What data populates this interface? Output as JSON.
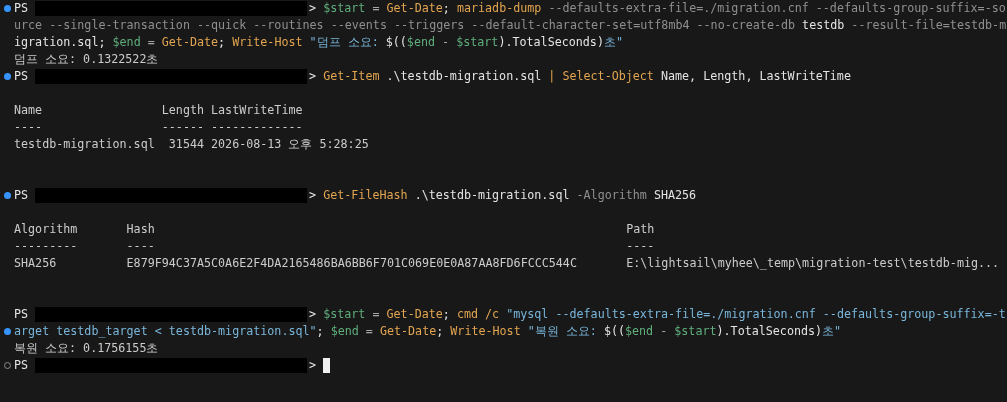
{
  "lines": [
    {
      "kind": "prompt",
      "dot": true,
      "dot_filled": true,
      "prompt": "PS",
      "prompt_end": ">",
      "segments": [
        {
          "kind": "variable",
          "text": "$start"
        },
        {
          "kind": "operator",
          "text": " = "
        },
        {
          "kind": "command",
          "text": "Get-Date"
        },
        {
          "kind": "plain",
          "text": "; "
        },
        {
          "kind": "command",
          "text": "mariadb-dump"
        },
        {
          "kind": "parameter",
          "text": " --defaults-extra-file=./migration.cnf --defaults-group-suffix=-so"
        }
      ]
    },
    {
      "kind": "code",
      "dot": false,
      "segments": [
        {
          "kind": "parameter",
          "text": "urce --single-transaction --quick --routines --events --triggers --default-character-set=utf8mb4 --no-create-db"
        },
        {
          "kind": "plain",
          "text": " testdb "
        },
        {
          "kind": "parameter",
          "text": "--result-file=testdb-m"
        }
      ]
    },
    {
      "kind": "code",
      "dot": false,
      "segments": [
        {
          "kind": "plain",
          "text": "igration.sql; "
        },
        {
          "kind": "variable",
          "text": "$end"
        },
        {
          "kind": "operator",
          "text": " = "
        },
        {
          "kind": "command",
          "text": "Get-Date"
        },
        {
          "kind": "plain",
          "text": "; "
        },
        {
          "kind": "command",
          "text": "Write-Host"
        },
        {
          "kind": "string",
          "text": " \"덤프 소요: "
        },
        {
          "kind": "plain",
          "text": "$(("
        },
        {
          "kind": "variable",
          "text": "$end"
        },
        {
          "kind": "operator",
          "text": " - "
        },
        {
          "kind": "variable",
          "text": "$start"
        },
        {
          "kind": "plain",
          "text": ").TotalSeconds)"
        },
        {
          "kind": "string",
          "text": "초\""
        }
      ]
    },
    {
      "kind": "output",
      "dot": false,
      "text": "덤프 소요: 0.1322522초"
    },
    {
      "kind": "prompt",
      "dot": true,
      "dot_filled": true,
      "prompt": "PS",
      "prompt_end": ">",
      "segments": [
        {
          "kind": "command",
          "text": "Get-Item"
        },
        {
          "kind": "plain",
          "text": " .\\testdb-migration.sql "
        },
        {
          "kind": "command",
          "text": "| Select-Object"
        },
        {
          "kind": "plain",
          "text": " Name, Length, LastWriteTime"
        }
      ]
    },
    {
      "kind": "blank",
      "dot": false
    },
    {
      "kind": "output",
      "dot": false,
      "text": "Name                 Length LastWriteTime"
    },
    {
      "kind": "output",
      "dot": false,
      "text": "----                 ------ -------------"
    },
    {
      "kind": "output",
      "dot": false,
      "text": "testdb-migration.sql  31544 2026-08-13 오후 5:28:25"
    },
    {
      "kind": "blank",
      "dot": false
    },
    {
      "kind": "blank",
      "dot": false
    },
    {
      "kind": "prompt",
      "dot": true,
      "dot_filled": true,
      "prompt": "PS",
      "prompt_end": ">",
      "segments": [
        {
          "kind": "command",
          "text": "Get-FileHash"
        },
        {
          "kind": "plain",
          "text": " .\\testdb-migration.sql "
        },
        {
          "kind": "parameter",
          "text": "-Algorithm"
        },
        {
          "kind": "plain",
          "text": " SHA256"
        }
      ]
    },
    {
      "kind": "blank",
      "dot": false
    },
    {
      "kind": "output",
      "dot": false,
      "text": "Algorithm       Hash                                                                   Path"
    },
    {
      "kind": "output",
      "dot": false,
      "text": "---------       ----                                                                   ----"
    },
    {
      "kind": "output",
      "dot": false,
      "text": "SHA256          E879F94C37A5C0A6E2F4DA2165486BA6BB6F701C069E0E0A87AA8FD6FCCC544C       E:\\lightsail\\myhee\\_temp\\migration-test\\testdb-mig..."
    },
    {
      "kind": "blank",
      "dot": false
    },
    {
      "kind": "blank",
      "dot": false
    },
    {
      "kind": "prompt",
      "dot": false,
      "prompt": "PS",
      "prompt_end": ">",
      "segments": [
        {
          "kind": "variable",
          "text": "$start"
        },
        {
          "kind": "operator",
          "text": " = "
        },
        {
          "kind": "command",
          "text": "Get-Date"
        },
        {
          "kind": "plain",
          "text": "; "
        },
        {
          "kind": "command",
          "text": "cmd /c"
        },
        {
          "kind": "string",
          "text": " \"mysql --defaults-extra-file=./migration.cnf --defaults-group-suffix=-t"
        }
      ]
    },
    {
      "kind": "code",
      "dot": true,
      "dot_filled": true,
      "segments": [
        {
          "kind": "string",
          "text": "arget testdb_target < testdb-migration.sql\""
        },
        {
          "kind": "plain",
          "text": "; "
        },
        {
          "kind": "variable",
          "text": "$end"
        },
        {
          "kind": "operator",
          "text": " = "
        },
        {
          "kind": "command",
          "text": "Get-Date"
        },
        {
          "kind": "plain",
          "text": "; "
        },
        {
          "kind": "command",
          "text": "Write-Host"
        },
        {
          "kind": "string",
          "text": " \"복원 소요: "
        },
        {
          "kind": "plain",
          "text": "$(("
        },
        {
          "kind": "variable",
          "text": "$end"
        },
        {
          "kind": "operator",
          "text": " - "
        },
        {
          "kind": "variable",
          "text": "$start"
        },
        {
          "kind": "plain",
          "text": ").TotalSeconds)"
        },
        {
          "kind": "string",
          "text": "초\""
        }
      ]
    },
    {
      "kind": "output",
      "dot": false,
      "text": "복원 소요: 0.1756155초"
    },
    {
      "kind": "prompt",
      "dot": true,
      "dot_filled": false,
      "prompt": "PS",
      "prompt_end": ">",
      "cursor": true
    }
  ]
}
